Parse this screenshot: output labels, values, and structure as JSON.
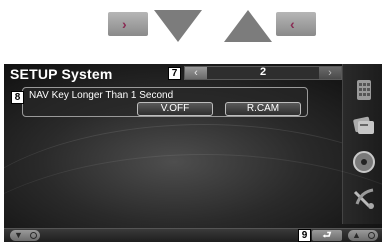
{
  "legend": {
    "right_key_glyph": "›",
    "left_key_glyph": "‹"
  },
  "screen": {
    "title": "SETUP System",
    "page_number": "2",
    "nav_prev_glyph": "‹",
    "nav_next_glyph": "›",
    "setting": {
      "label": "NAV Key Longer Than 1 Second",
      "options": [
        "V.OFF",
        "R.CAM"
      ]
    },
    "side_menu": [
      {
        "icon": "keypad-icon"
      },
      {
        "icon": "cards-icon"
      },
      {
        "icon": "disc-icon"
      },
      {
        "icon": "satellite-dish-icon"
      }
    ],
    "bottom_bar": {
      "down_glyph": "▼",
      "up_glyph": "▲",
      "return_glyph": "⮐"
    }
  },
  "callouts": {
    "page_nav": "7",
    "setting_item": "8",
    "return": "9"
  },
  "colors": {
    "chevron_accent": "#8a2b54",
    "screen_bg": "#1a1a1a"
  }
}
